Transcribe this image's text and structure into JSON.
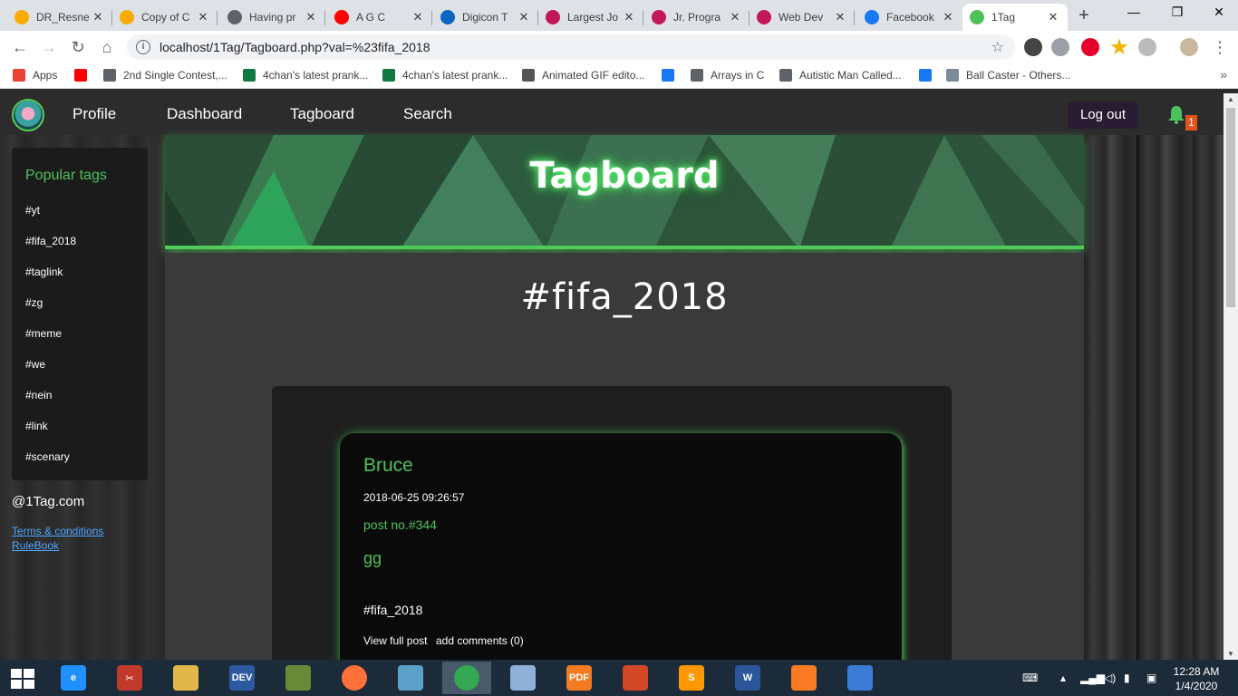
{
  "browser": {
    "tabs": [
      {
        "title": "DR_Resne",
        "favicon": "colab-icon",
        "color": "#f9ab00"
      },
      {
        "title": "Copy of C",
        "favicon": "colab-icon",
        "color": "#f9ab00"
      },
      {
        "title": "Having pr",
        "favicon": "chat-icon",
        "color": "#5f6368"
      },
      {
        "title": "A G C",
        "favicon": "youtube-icon",
        "color": "#ff0000"
      },
      {
        "title": "Digicon T",
        "favicon": "linkedin-icon",
        "color": "#0a66c2"
      },
      {
        "title": "Largest Jo",
        "favicon": "jobs-icon",
        "color": "#c2185b"
      },
      {
        "title": "Jr. Progra",
        "favicon": "jobs-icon",
        "color": "#c2185b"
      },
      {
        "title": "Web Dev",
        "favicon": "jobs-icon",
        "color": "#c2185b"
      },
      {
        "title": "Facebook",
        "favicon": "facebook-icon",
        "color": "#1877f2"
      },
      {
        "title": "1Tag",
        "favicon": "tag-icon",
        "color": "#4fc15a"
      }
    ],
    "url": "localhost/1Tag/Tagboard.php?val=%23fifa_2018",
    "bookmarks": [
      {
        "label": "Apps",
        "icon": "apps-grid-icon",
        "color": "#ea4335"
      },
      {
        "label": "",
        "icon": "youtube-icon",
        "color": "#ff0000"
      },
      {
        "label": "2nd Single Contest,...",
        "icon": "globe-icon",
        "color": "#5f6368"
      },
      {
        "label": "4chan's latest prank...",
        "icon": "clover-icon",
        "color": "#117743"
      },
      {
        "label": "4chan's latest prank...",
        "icon": "clover-icon",
        "color": "#117743"
      },
      {
        "label": "Animated GIF edito...",
        "icon": "gif-editor-icon",
        "color": "#555555"
      },
      {
        "label": "",
        "icon": "facebook-icon",
        "color": "#1877f2"
      },
      {
        "label": "Arrays in C",
        "icon": "diamond-icon",
        "color": "#5f6368"
      },
      {
        "label": "Autistic Man Called...",
        "icon": "globe-icon",
        "color": "#5f6368"
      },
      {
        "label": "",
        "icon": "facebook-icon",
        "color": "#1877f2"
      },
      {
        "label": "Ball Caster - Others...",
        "icon": "thumbnail-icon",
        "color": "#7a8a99"
      }
    ]
  },
  "site": {
    "nav": {
      "profile": "Profile",
      "dashboard": "Dashboard",
      "tagboard": "Tagboard",
      "search": "Search",
      "logout": "Log out",
      "notification_count": "1"
    },
    "sidebar": {
      "title": "Popular tags",
      "tags": [
        "#yt",
        "#fifa_2018",
        "#taglink",
        "#zg",
        "#meme",
        "#we",
        "#nein",
        "#link",
        "#scenary"
      ],
      "site_name": "@1Tag.com",
      "links": [
        "Terms & conditions",
        "RuleBook"
      ]
    },
    "banner_title": "Tagboard",
    "current_tag": "#fifa_2018",
    "post": {
      "author": "Bruce",
      "datetime": "2018-06-25 09:26:57",
      "post_no": "post no.#344",
      "body": "gg",
      "tag": "#fifa_2018",
      "view_label": "View full post",
      "comments_label": "add comments (0)"
    },
    "colors": {
      "accent_green": "#4fc15a",
      "logout_bg": "#2a1d33",
      "badge": "#e0531d",
      "link_blue": "#4fa6ff"
    }
  },
  "taskbar": {
    "apps": [
      {
        "name": "internet-explorer-icon",
        "label": "e",
        "color": "#1e90ff"
      },
      {
        "name": "snipping-tool-icon",
        "label": "✂",
        "color": "#c0392b"
      },
      {
        "name": "file-explorer-icon",
        "label": "",
        "color": "#e0b84a"
      },
      {
        "name": "dev-cpp-icon",
        "label": "DEV",
        "color": "#2c5aa0"
      },
      {
        "name": "notepad-plus-icon",
        "label": "",
        "color": "#6a8a3a"
      },
      {
        "name": "firefox-icon",
        "label": "",
        "color": "#ff7139"
      },
      {
        "name": "notes-icon",
        "label": "",
        "color": "#5aa0c8"
      },
      {
        "name": "chrome-icon",
        "label": "",
        "color": "#34a853"
      },
      {
        "name": "paint-icon",
        "label": "",
        "color": "#8fb0d8"
      },
      {
        "name": "foxit-pdf-icon",
        "label": "PDF",
        "color": "#f47b20"
      },
      {
        "name": "powerpoint-icon",
        "label": "",
        "color": "#d24726"
      },
      {
        "name": "sublime-text-icon",
        "label": "S",
        "color": "#ff9800"
      },
      {
        "name": "word-icon",
        "label": "W",
        "color": "#2b579a"
      },
      {
        "name": "xampp-icon",
        "label": "",
        "color": "#fb7a24"
      },
      {
        "name": "photos-icon",
        "label": "",
        "color": "#3a7bd5"
      }
    ],
    "time": "12:28 AM",
    "date": "1/4/2020"
  }
}
